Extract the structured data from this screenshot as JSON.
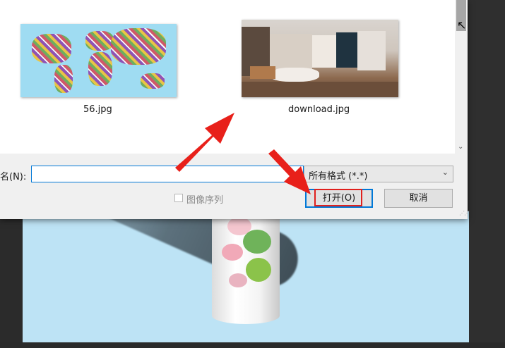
{
  "dialog": {
    "files": [
      {
        "name": "56.jpg",
        "kind": "world-map-mosaic"
      },
      {
        "name": "download.jpg",
        "kind": "panorama-room"
      }
    ],
    "filename_label": "名(N):",
    "filename_value": "",
    "filetype_value": "所有格式 (*.*)",
    "image_sequence_label": "图像序列",
    "image_sequence_checked": false,
    "open_button": "打开(O)",
    "cancel_button": "取消"
  },
  "annotations": {
    "arrow_color": "#e8201a",
    "highlight_color": "#e0201d"
  },
  "colors": {
    "accent": "#0078d7",
    "canvas_bg": "#bde3f5"
  }
}
